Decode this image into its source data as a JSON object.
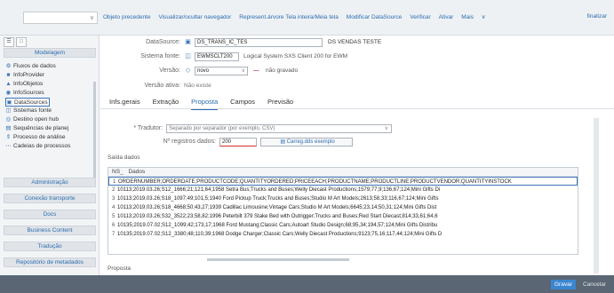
{
  "toolbar": {
    "combo_value": "",
    "items": [
      "Objeto precedente",
      "Visualizar/ocultar navegador",
      "Represent.árvore Tela inteira/Meia tela",
      "Modificar DataSource",
      "Verificar",
      "Ativar",
      "Mais"
    ],
    "finalizar": "finalizar"
  },
  "sidebar": {
    "section_modelagem": "Modelagem",
    "items": [
      {
        "label": "Fluxos de dados",
        "icon": "flow-icon"
      },
      {
        "label": "InfoProvider",
        "icon": "cube-icon"
      },
      {
        "label": "InfoObjetos",
        "icon": "triangle-icon"
      },
      {
        "label": "InfoSources",
        "icon": "source-icon"
      },
      {
        "label": "DataSources",
        "icon": "datasource-icon"
      },
      {
        "label": "Sistemas fonte",
        "icon": "system-icon"
      },
      {
        "label": "Destino open hub",
        "icon": "target-icon"
      },
      {
        "label": "Sequências de planej",
        "icon": "sequence-icon"
      },
      {
        "label": "Processo de análise",
        "icon": "analysis-icon"
      },
      {
        "label": "Cadeias de processos",
        "icon": "chain-icon"
      }
    ],
    "sections": [
      "Administração",
      "Conexão transporte",
      "Docs",
      "Business Content",
      "Tradução",
      "Repositório de metadados"
    ]
  },
  "form": {
    "datasource_label": "DataSource:",
    "datasource_value": "DS_TRANS_IC_TES",
    "datasource_desc": "DS VENDAS TESTE",
    "sistema_label": "Sistema fonte:",
    "sistema_value": "EWMSCLT200",
    "sistema_desc": "Logical System SXS Client 200 for EWM",
    "versao_label": "Versão:",
    "versao_value": "novo",
    "versao_status": "não gravado",
    "versao_ativa_label": "Versão ativa:",
    "versao_ativa_value": "Não existe"
  },
  "tabs": [
    "Infs.gerais",
    "Extração",
    "Proposta",
    "Campos",
    "Previsão"
  ],
  "active_tab": "Proposta",
  "proposta": {
    "tradutor_label": "* Tradutor:",
    "tradutor_value": "Separado por separador (por exemplo, CSV)",
    "registros_label": "Nº registros dados:",
    "registros_value": "200",
    "carreg_button": "Carreg.dds exemplo",
    "saida_label": "Saída dados"
  },
  "grid": {
    "header_ns": "NS_",
    "header_dados": "Dados",
    "rows": [
      {
        "n": "1",
        "text": "ORDERNUMBER;ORDERDATE;PRODUCTCODE;QUANTITYORDERED;PRICEEACH;PRODUCTNAME;PRODUCTLINE;PRODUCTVENDOR;QUANTITYINSTOCK"
      },
      {
        "n": "2",
        "text": "10113;2019.03.26;S12_1666;21;121,64;1958 Setra Bus;Trucks and Buses;Welly Diecast Productions;1579;77,9;136,67;124;Mini Gifts Di"
      },
      {
        "n": "3",
        "text": "10113;2019.03.26;S18_1097;49;101,5;1940 Ford Pickup Truck;Trucks and Buses;Studio M Art Models;2613;58,33;116,67;124;Mini Gifts"
      },
      {
        "n": "4",
        "text": "10113;2019.03.26;S18_4668;50;43,27;1939 Cadillac Limousine;Vintage Cars;Studio M Art Models;6645;23,14;50,31;124;Mini Gifts Dist"
      },
      {
        "n": "5",
        "text": "10113;2019.03.26;S32_3522;23;58,82;1996 Peterbilt 379 Stake Bed with Outrigger;Trucks and Buses;Red Start Diecast;814;33,61;64,6"
      },
      {
        "n": "6",
        "text": "10135;2019.07.02;S12_1099;42;173,17;1968 Ford Mustang;Classic Cars;Autoart Studio Design;68;95,34;194,57;124;Mini Gifts Distribu"
      },
      {
        "n": "7",
        "text": "10135;2019.07.02;S12_3380;48;110,39;1968 Dodge Charger;Classic Cars;Welly Diecast Productions;9123;75,16;117,44;124;Mini Gifts D"
      }
    ]
  },
  "proposta_footer": "Proposta",
  "bottom": {
    "gravar": "Gravar",
    "cancelar": "Cancelar"
  },
  "colors": {
    "accent": "#2b6cb0",
    "toolbar_bg": "#eef1f4",
    "bottom_bg": "#5a6673",
    "primary_button": "#3b86d1",
    "status_red": "#d32f2f"
  }
}
